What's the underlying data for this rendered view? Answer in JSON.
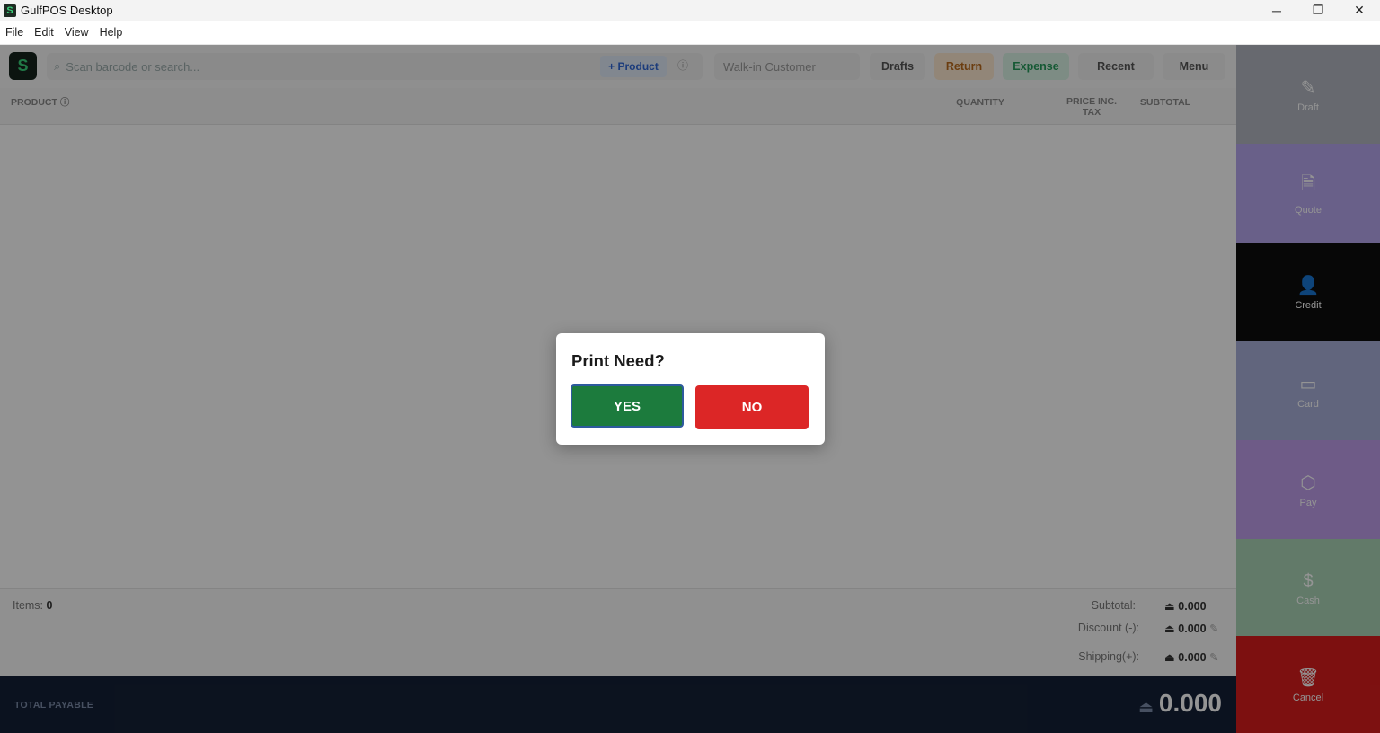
{
  "window": {
    "title": "GulfPOS Desktop",
    "icon": "S",
    "minimize": "─",
    "maximize": "❐",
    "close": "✕"
  },
  "menubar": {
    "items": [
      "File",
      "Edit",
      "View",
      "Help"
    ]
  },
  "toolbar": {
    "logo": "S",
    "search_placeholder": "Scan barcode or search...",
    "product_button": "+ Product",
    "customer": "Walk-in Customer",
    "drafts": "Drafts",
    "return": "Return",
    "expense": "Expense",
    "recent": "Recent",
    "menu": "Menu"
  },
  "table": {
    "columns": {
      "product": "PRODUCT ⓘ",
      "quantity": "QUANTITY",
      "price": "PRICE INC. TAX",
      "subtotal": "SUBTOTAL"
    }
  },
  "summary": {
    "items_label": "Items:",
    "items_count": "0",
    "subtotal_label": "Subtotal:",
    "subtotal_value": "0.000",
    "discount_label": "Discount (-):",
    "discount_value": "0.000",
    "shipping_label": "Shipping(+):",
    "shipping_value": "0.000",
    "currency_symbol": "⏏"
  },
  "total": {
    "label": "TOTAL PAYABLE",
    "value": "0.000"
  },
  "side_buttons": [
    {
      "label": "Draft",
      "icon": "✎",
      "color": "#b1b6bf"
    },
    {
      "label": "Quote",
      "icon": "🗎",
      "color": "#b6a6ec"
    },
    {
      "label": "Credit",
      "icon": "👤",
      "color": "#0d0d0d"
    },
    {
      "label": "Card",
      "icon": "▭",
      "color": "#a8aed7"
    },
    {
      "label": "Pay",
      "icon": "⬡",
      "color": "#bd9ee8"
    },
    {
      "label": "Cash",
      "icon": "$",
      "color": "#a9d2b6"
    },
    {
      "label": "Cancel",
      "icon": "🗑",
      "color": "#d71d1d"
    }
  ],
  "dialog": {
    "title": "Print Need?",
    "yes": "YES",
    "no": "NO"
  }
}
